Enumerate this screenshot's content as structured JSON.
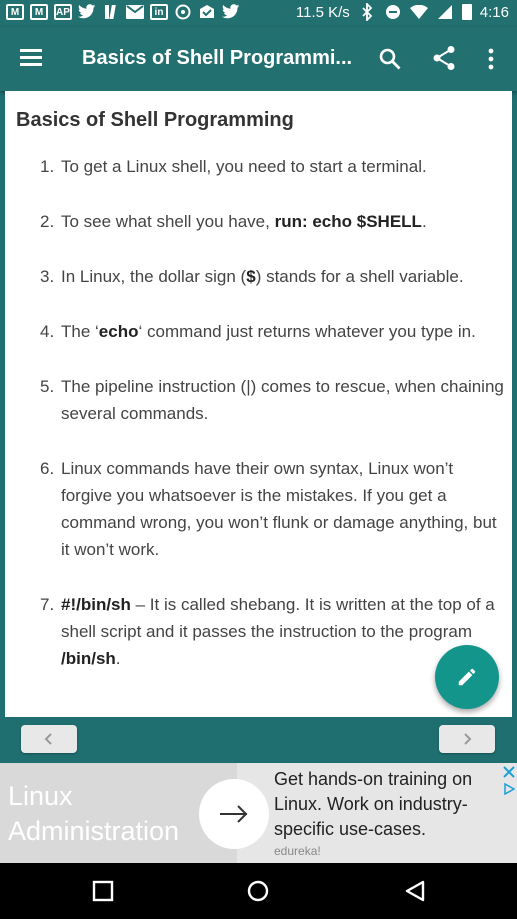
{
  "status_bar": {
    "icons_left": [
      "gmail-icon",
      "gmail-icon",
      "ap-icon",
      "twitter-icon",
      "flipboard-icon",
      "mail-icon",
      "linkedin-icon",
      "whatsapp-icon",
      "check-mail-icon",
      "twitter-icon"
    ],
    "ap_label": "AP",
    "net_speed": "11.5 K/s",
    "time": "4:16"
  },
  "app_bar": {
    "title": "Basics of Shell Programmi..."
  },
  "content": {
    "heading": "Basics of Shell Programming",
    "items": [
      {
        "num": "1.",
        "parts": [
          {
            "t": "To get a Linux shell, you need to start a terminal.",
            "b": false
          }
        ]
      },
      {
        "num": "2.",
        "parts": [
          {
            "t": "To see what shell you have, ",
            "b": false
          },
          {
            "t": "run: echo $SHELL",
            "b": true
          },
          {
            "t": ".",
            "b": false
          }
        ]
      },
      {
        "num": "3.",
        "parts": [
          {
            "t": "In Linux, the dollar sign (",
            "b": false
          },
          {
            "t": "$",
            "b": true
          },
          {
            "t": ") stands for a shell variable.",
            "b": false
          }
        ]
      },
      {
        "num": "4.",
        "parts": [
          {
            "t": "The ‘",
            "b": false
          },
          {
            "t": "echo",
            "b": true
          },
          {
            "t": "‘ command just returns whatever you type in.",
            "b": false
          }
        ]
      },
      {
        "num": "5.",
        "parts": [
          {
            "t": "The pipeline instruction (|) comes to rescue, when chaining several commands.",
            "b": false
          }
        ]
      },
      {
        "num": "6.",
        "parts": [
          {
            "t": "Linux commands have their own syntax, Linux won’t forgive you whatsoever is the mistakes. If you get a command wrong, you won’t flunk or damage anything, but it won’t work.",
            "b": false
          }
        ]
      },
      {
        "num": "7.",
        "parts": [
          {
            "t": "#!/bin/sh",
            "b": true
          },
          {
            "t": " – It is called shebang. It is written at the top of a shell script and it passes the instruction to the program ",
            "b": false
          },
          {
            "t": "/bin/sh",
            "b": true
          },
          {
            "t": ".",
            "b": false
          }
        ]
      }
    ]
  },
  "ad": {
    "brand_line1": "Linux",
    "brand_line2": "Administration",
    "text": "Get hands-on training on Linux. Work on industry-specific use-cases.",
    "source": "edureka!"
  },
  "colors": {
    "primary": "#22706f",
    "fab": "#14958c"
  }
}
